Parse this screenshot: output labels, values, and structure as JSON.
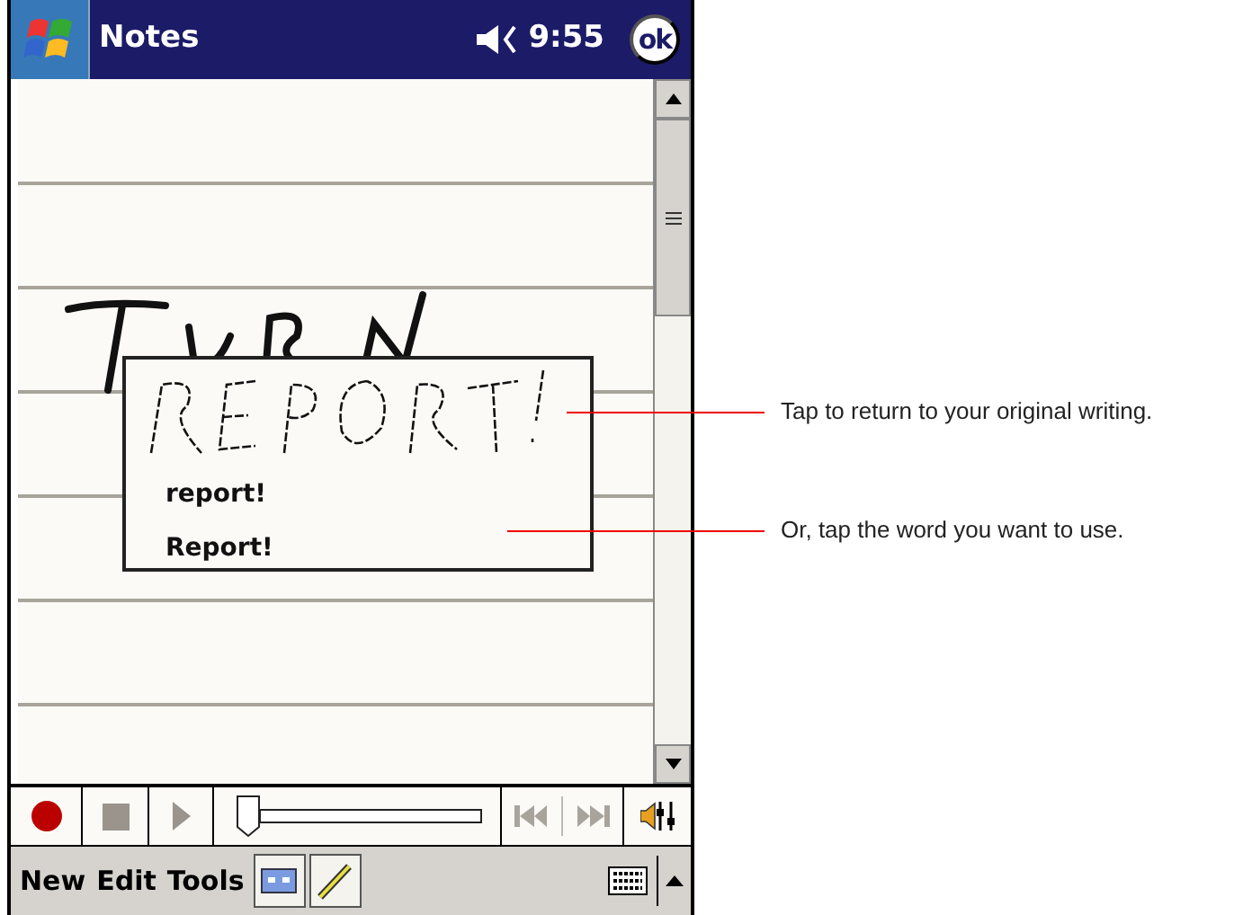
{
  "title_bar": {
    "title": "Notes",
    "time": "9:55",
    "ok_label": "ok"
  },
  "note": {
    "alternatives": [
      "report!",
      "Report!"
    ]
  },
  "recorder": {
    "position": {
      "level": 0
    }
  },
  "menu_bar": {
    "items": [
      "New",
      "Edit",
      "Tools"
    ]
  },
  "callouts": [
    "Tap to return to your original writing.",
    "Or, tap the word you want to use."
  ]
}
